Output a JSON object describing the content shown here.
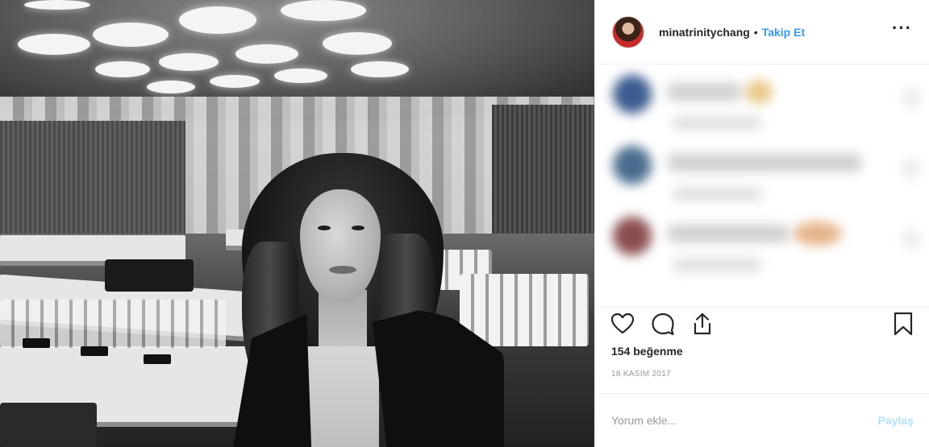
{
  "post": {
    "username": "minatrinitychang",
    "separator": "•",
    "follow_label": "Takip Et",
    "more_icon": "more-options-icon",
    "likes_text": "154 beğenme",
    "date_text": "18 KASIM 2017"
  },
  "comment_form": {
    "placeholder": "Yorum ekle...",
    "submit_label": "Paylaş"
  },
  "colors": {
    "link_blue": "#3897f0",
    "disabled_blue": "#b2dffc",
    "border": "#efefef",
    "muted": "#999999"
  },
  "icons": [
    "heart-icon",
    "comment-icon",
    "share-icon",
    "bookmark-icon"
  ]
}
